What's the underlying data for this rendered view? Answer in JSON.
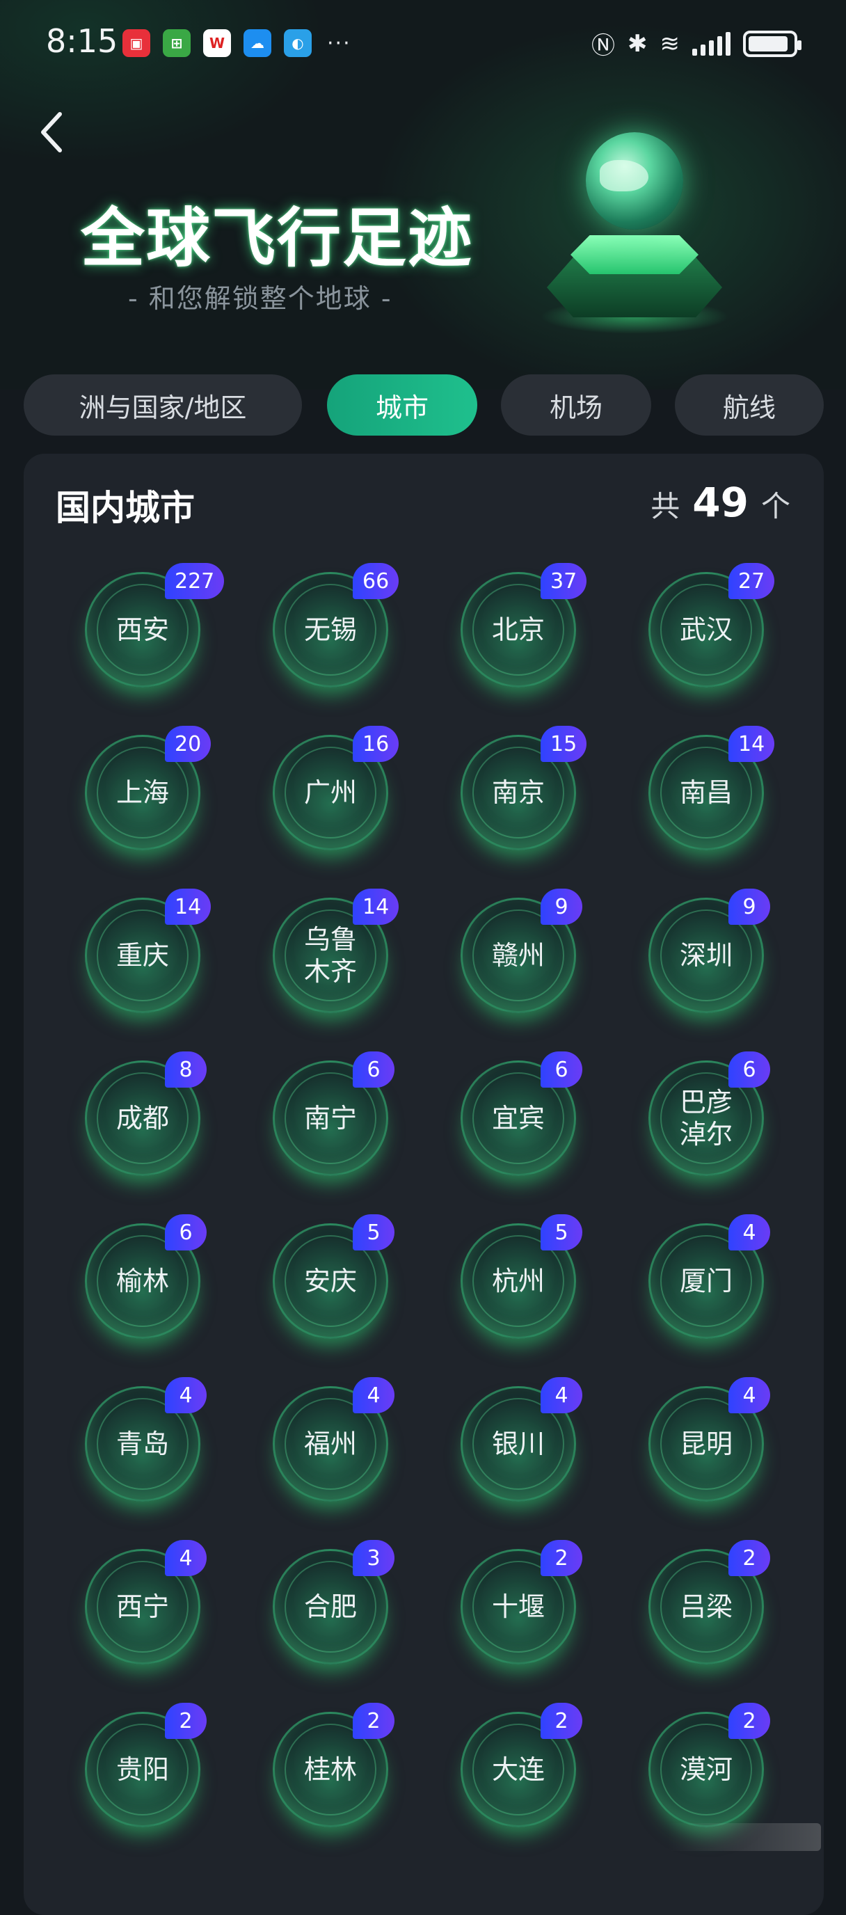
{
  "status_bar": {
    "time": "8:15",
    "app_icons": [
      "huawei-appgallery-icon",
      "green-app-icon",
      "wps-icon",
      "cloud-icon",
      "browser-icon"
    ],
    "more": "···",
    "battery_level": 0.9
  },
  "header": {
    "title": "全球飞行足迹",
    "subtitle": "- 和您解锁整个地球 -"
  },
  "tabs": [
    {
      "label": "洲与国家/地区",
      "active": false
    },
    {
      "label": "城市",
      "active": true
    },
    {
      "label": "机场",
      "active": false
    },
    {
      "label": "航线",
      "active": false
    }
  ],
  "card": {
    "title": "国内城市",
    "count_prefix": "共",
    "count": "49",
    "count_suffix": "个"
  },
  "cities": [
    {
      "name": "西安",
      "count": "227"
    },
    {
      "name": "无锡",
      "count": "66"
    },
    {
      "name": "北京",
      "count": "37"
    },
    {
      "name": "武汉",
      "count": "27"
    },
    {
      "name": "上海",
      "count": "20"
    },
    {
      "name": "广州",
      "count": "16"
    },
    {
      "name": "南京",
      "count": "15"
    },
    {
      "name": "南昌",
      "count": "14"
    },
    {
      "name": "重庆",
      "count": "14"
    },
    {
      "name": "乌鲁木齐",
      "count": "14"
    },
    {
      "name": "赣州",
      "count": "9"
    },
    {
      "name": "深圳",
      "count": "9"
    },
    {
      "name": "成都",
      "count": "8"
    },
    {
      "name": "南宁",
      "count": "6"
    },
    {
      "name": "宜宾",
      "count": "6"
    },
    {
      "name": "巴彦淖尔",
      "count": "6"
    },
    {
      "name": "榆林",
      "count": "6"
    },
    {
      "name": "安庆",
      "count": "5"
    },
    {
      "name": "杭州",
      "count": "5"
    },
    {
      "name": "厦门",
      "count": "4"
    },
    {
      "name": "青岛",
      "count": "4"
    },
    {
      "name": "福州",
      "count": "4"
    },
    {
      "name": "银川",
      "count": "4"
    },
    {
      "name": "昆明",
      "count": "4"
    },
    {
      "name": "西宁",
      "count": "4"
    },
    {
      "name": "合肥",
      "count": "3"
    },
    {
      "name": "十堰",
      "count": "2"
    },
    {
      "name": "吕梁",
      "count": "2"
    },
    {
      "name": "贵阳",
      "count": "2"
    },
    {
      "name": "桂林",
      "count": "2"
    },
    {
      "name": "大连",
      "count": "2"
    },
    {
      "name": "漠河",
      "count": "2"
    }
  ]
}
